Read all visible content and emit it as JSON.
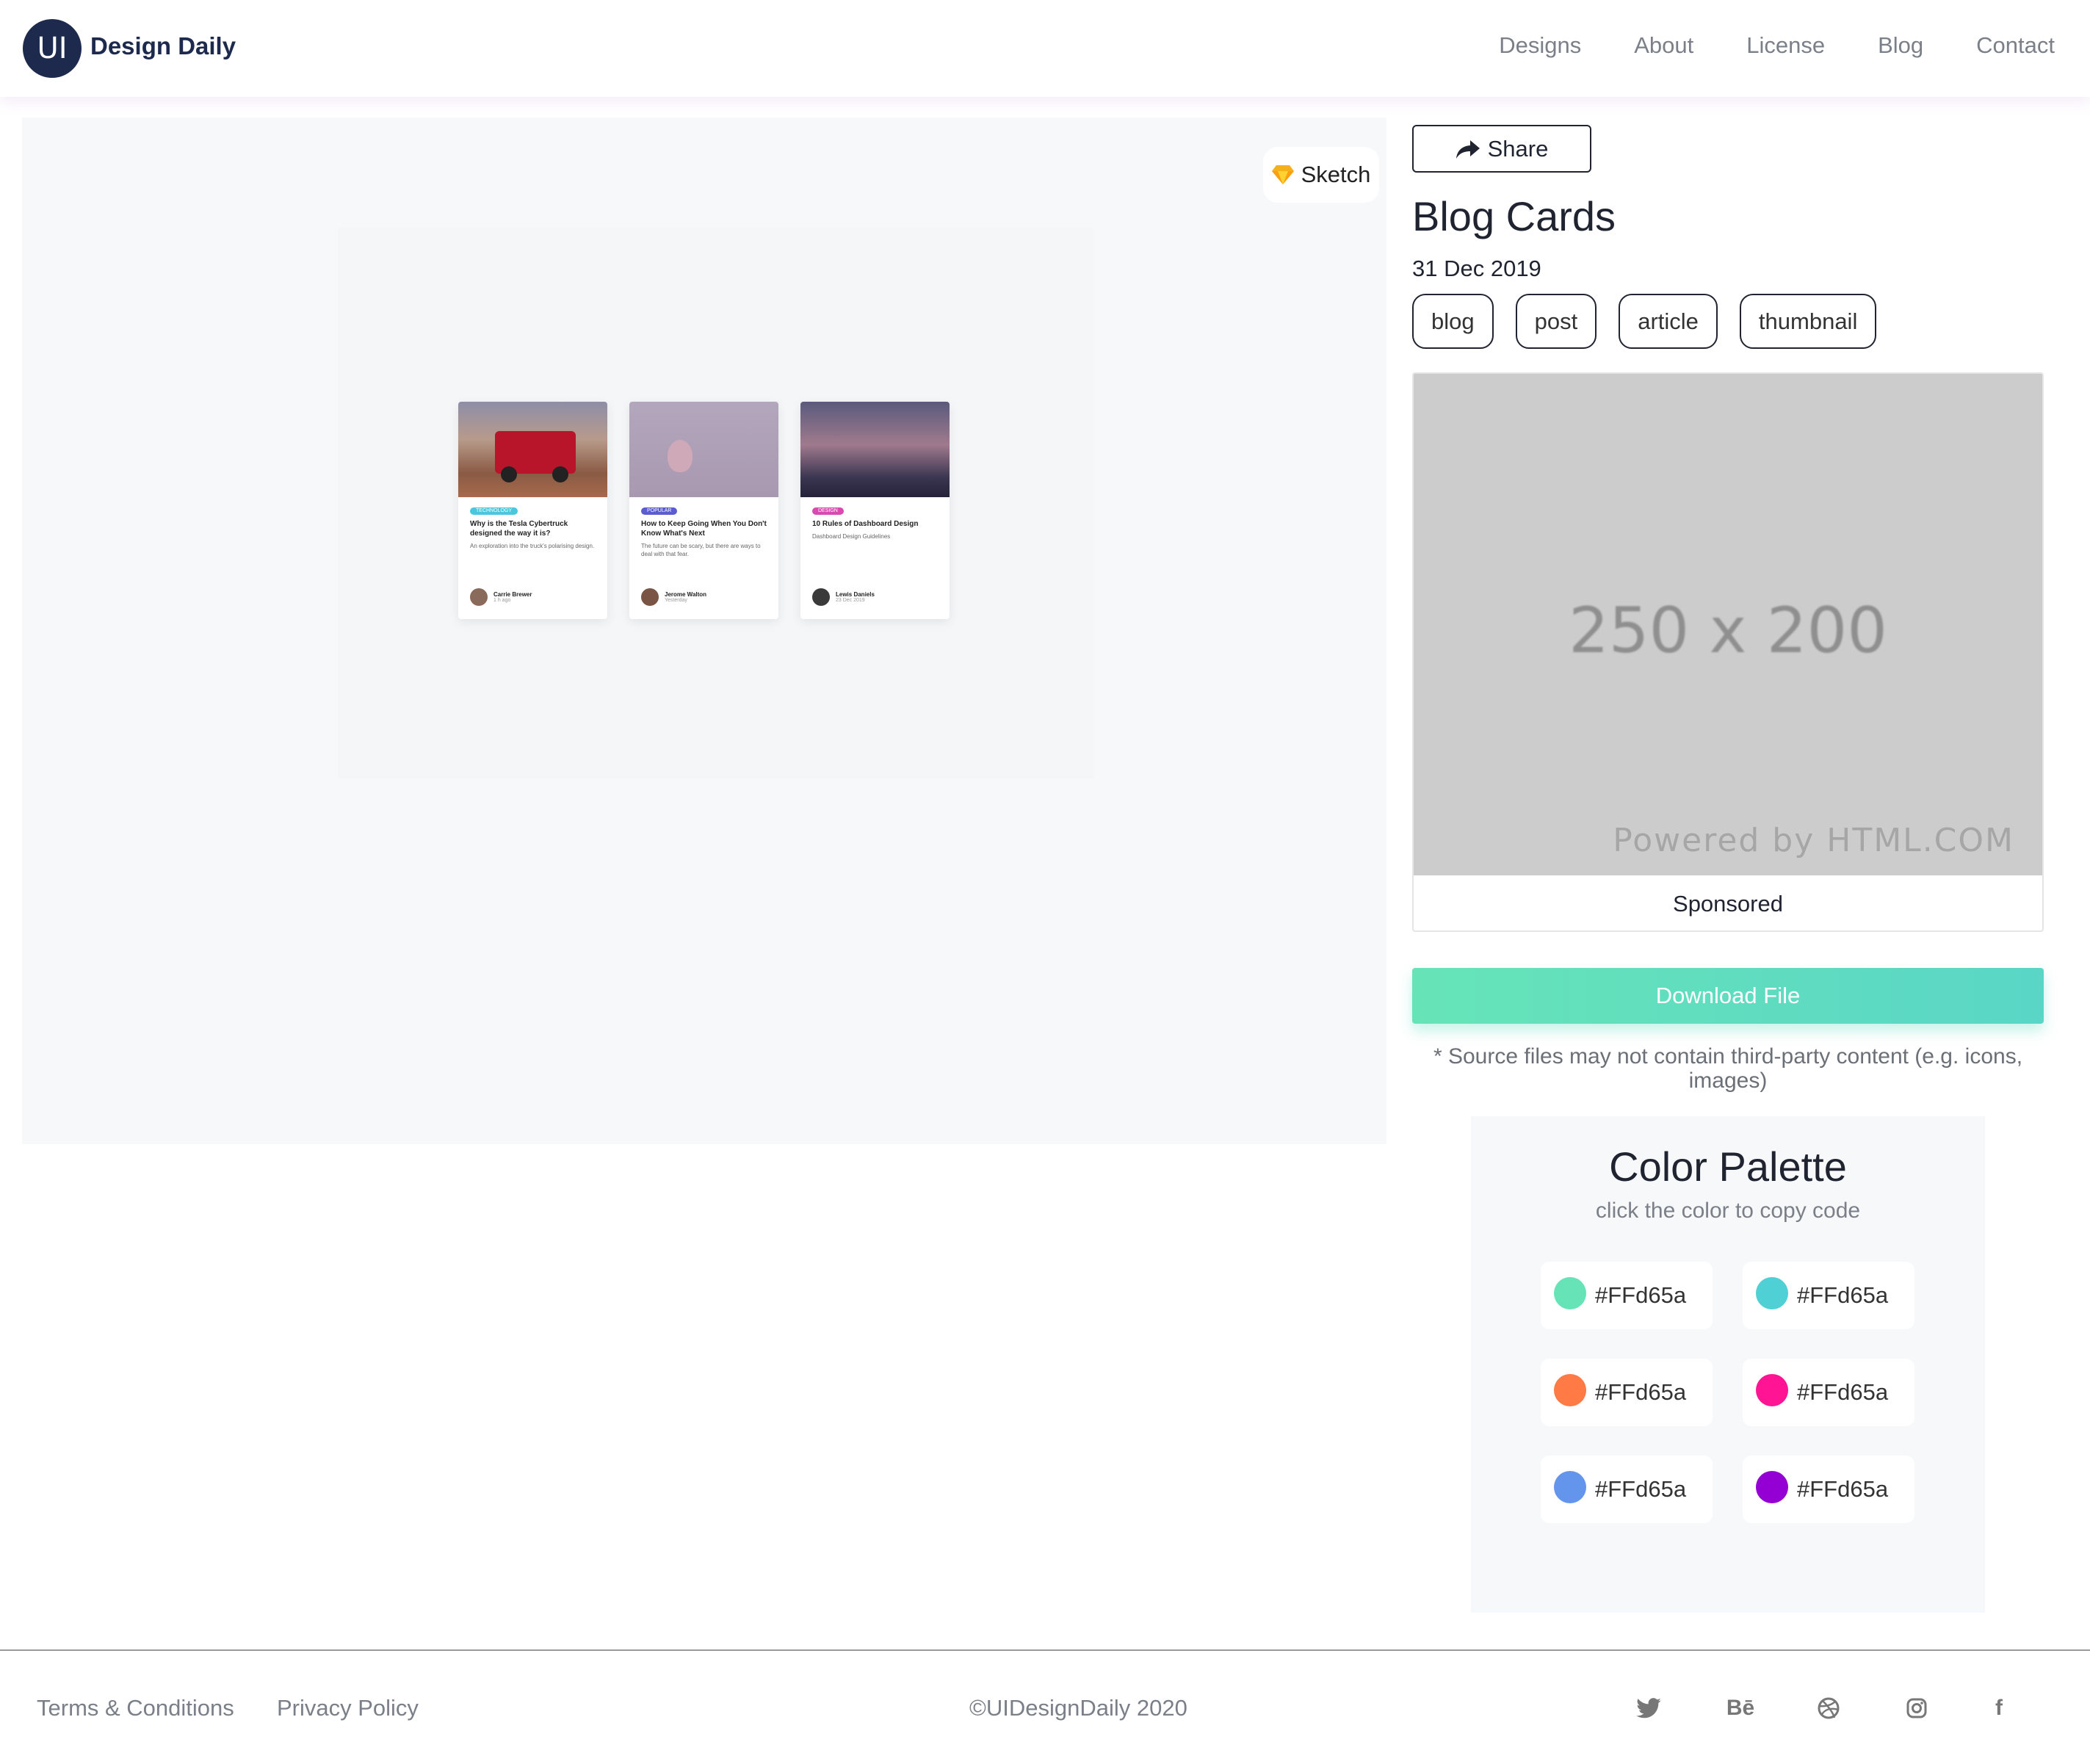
{
  "nav": {
    "logo_badge": "UI",
    "logo_text": "Design Daily",
    "links": [
      "Designs",
      "About",
      "License",
      "Blog",
      "Contact"
    ]
  },
  "preview": {
    "sketch_label": "Sketch",
    "cards": [
      {
        "tag": "TECHNOLOGY",
        "tag_color": "#4cc6dd",
        "title": "Why is the Tesla Cybertruck designed the way it is?",
        "desc": "An exploration into the truck's polarising design.",
        "author": "Carrie Brewer",
        "time": "1 h ago"
      },
      {
        "tag": "POPULAR",
        "tag_color": "#5a5ccf",
        "title": "How to Keep Going When You Don't Know What's Next",
        "desc": "The future can be scary, but there are ways to deal with that fear.",
        "author": "Jerome Walton",
        "time": "Yesterday"
      },
      {
        "tag": "DESIGN",
        "tag_color": "#d94ab1",
        "title": "10 Rules of Dashboard Design",
        "desc": "Dashboard Design Guidelines",
        "author": "Lewis Daniels",
        "time": "23 Dec 2019"
      }
    ]
  },
  "sidebar": {
    "share_label": "Share",
    "title": "Blog Cards",
    "date": "31 Dec 2019",
    "tags": [
      "blog",
      "post",
      "article",
      "thumbnail"
    ],
    "ad": {
      "size_text": "250 x 200",
      "powered": "Powered by HTML.COM",
      "label": "Sponsored"
    },
    "download_label": "Download File",
    "note": "* Source files may not contain third-party content (e.g. icons, images)"
  },
  "palette": {
    "title": "Color Palette",
    "subtitle": "click the color to copy code",
    "swatches": [
      {
        "label": "#FFd65a",
        "color": "#66e4b8"
      },
      {
        "label": "#FFd65a",
        "color": "#4fd0d4"
      },
      {
        "label": "#FFd65a",
        "color": "#ff7a45"
      },
      {
        "label": "#FFd65a",
        "color": "#ff1493"
      },
      {
        "label": "#FFd65a",
        "color": "#6495ed"
      },
      {
        "label": "#FFd65a",
        "color": "#9400d3"
      }
    ]
  },
  "footer": {
    "terms": "Terms & Conditions",
    "privacy": "Privacy Policy",
    "copyright": "©UIDesignDaily 2020",
    "social_icons": [
      "twitter-icon",
      "behance-icon",
      "dribbble-icon",
      "instagram-icon",
      "facebook-icon"
    ],
    "behance_text": "Bē",
    "facebook_text": "f"
  }
}
